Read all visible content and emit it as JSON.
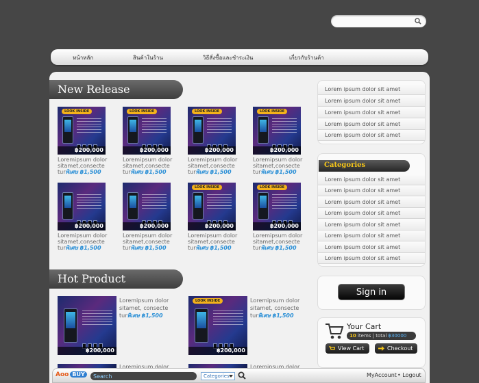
{
  "search": {
    "placeholder": ""
  },
  "nav": {
    "items": [
      "หน้าหลัก",
      "สินค้าในร้าน",
      "วิธีสั่งซื้อและชำระเงิน",
      "เกี่ยวกับร้านค้า"
    ]
  },
  "new_release": {
    "title": "New Release",
    "products": [
      {
        "badge": "LOOK INSIDE",
        "price": "฿200,000",
        "desc1": "Loremipsum dolor",
        "desc2": "sitamet,consecte",
        "desc3": "tur",
        "sale": "พิเศษ ฿1,500"
      },
      {
        "badge": "LOOK INSIDE",
        "price": "฿200,000",
        "desc1": "Loremipsum dolor",
        "desc2": "sitamet,consecte",
        "desc3": "tur",
        "sale": "พิเศษ ฿1,500"
      },
      {
        "badge": "LOOK INSIDE",
        "price": "฿200,000",
        "desc1": "Loremipsum dolor",
        "desc2": "sitamet,consecte",
        "desc3": "tur",
        "sale": "พิเศษ ฿1,500"
      },
      {
        "badge": "LOOK INSIDE",
        "price": "฿200,000",
        "desc1": "Loremipsum dolor",
        "desc2": "sitamet,consecte",
        "desc3": "tur",
        "sale": "พิเศษ ฿1,500"
      },
      {
        "badge": "",
        "price": "฿200,000",
        "desc1": "Loremipsum dolor",
        "desc2": "sitamet,consecte",
        "desc3": "tur",
        "sale": "พิเศษ ฿1,500"
      },
      {
        "badge": "",
        "price": "฿200,000",
        "desc1": "Loremipsum dolor",
        "desc2": "sitamet,consecte",
        "desc3": "tur",
        "sale": "พิเศษ ฿1,500"
      },
      {
        "badge": "LOOK INSIDE",
        "price": "฿200,000",
        "desc1": "Loremipsum dolor",
        "desc2": "sitamet,consecte",
        "desc3": "tur",
        "sale": "พิเศษ ฿1,500"
      },
      {
        "badge": "LOOK INSIDE",
        "price": "฿200,000",
        "desc1": "Loremipsum dolor",
        "desc2": "sitamet,consecte",
        "desc3": "tur",
        "sale": "พิเศษ ฿1,500"
      }
    ]
  },
  "hot_product": {
    "title": "Hot Product",
    "products": [
      {
        "badge": "",
        "price": "฿200,000",
        "desc1": "Loremipsum dolor",
        "desc2": "sitamet, consecte",
        "desc3": "tur",
        "sale": "พิเศษ ฿1,500"
      },
      {
        "badge": "LOOK INSIDE",
        "price": "฿200,000",
        "desc1": "Loremipsum dolor",
        "desc2": "sitamet, consecte",
        "desc3": "tur",
        "sale": "พิเศษ ฿1,500"
      }
    ],
    "partial": [
      "Loremipsum dolor",
      "Loremipsum dolor"
    ]
  },
  "side_links": [
    "Lorem ipsum dolor sit amet",
    "Lorem ipsum dolor sit amet",
    "Lorem ipsum dolor sit amet",
    "Lorem ipsum dolor sit amet",
    "Lorem ipsum dolor sit amet"
  ],
  "categories": {
    "title": "Categories",
    "items": [
      "Lorem ipsum dolor sit amet",
      "Lorem ipsum dolor sit amet",
      "Lorem ipsum dolor sit amet",
      "Lorem ipsum dolor sit amet",
      "Lorem ipsum dolor sit amet",
      "Lorem ipsum dolor sit amet",
      "Lorem ipsum dolor sit amet",
      "Lorem ipsum dolor sit amet"
    ]
  },
  "signin": {
    "label": "Sign in"
  },
  "cart": {
    "title": "Your Cart",
    "count": "10",
    "items_label": "items | total",
    "amount": "฿30000",
    "view_label": "View Cart",
    "checkout_label": "Checkout"
  },
  "toolbar": {
    "logo": "Aoo",
    "logo_buy": "BUY",
    "search_value": "Search",
    "select_value": "Categories",
    "account_label": "MyAccount",
    "logout_label": "Logout"
  },
  "colors": {
    "background": "#464646",
    "accent_gold": "#f5c518",
    "sale_blue": "#2a8fd6"
  }
}
